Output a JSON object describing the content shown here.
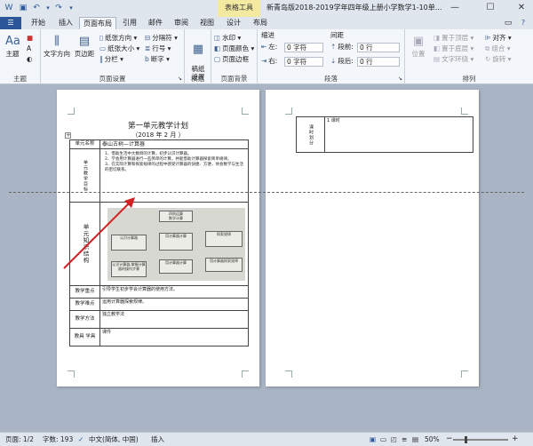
{
  "title_bar": {
    "context_tool": "表格工具",
    "doc_title": "新青岛版2018-2019学年四年级上册小学数学1-10单...",
    "help": "?",
    "restore_ribbon": "▭",
    "minimize": "—",
    "maximize": "☐",
    "close": "✕"
  },
  "tabs": [
    {
      "label": "开始"
    },
    {
      "label": "插入"
    },
    {
      "label": "页面布局"
    },
    {
      "label": "引用"
    },
    {
      "label": "邮件"
    },
    {
      "label": "审阅"
    },
    {
      "label": "视图"
    },
    {
      "label": "设计"
    },
    {
      "label": "布局"
    }
  ],
  "ribbon": {
    "theme": {
      "big_label": "主题",
      "colors": "■",
      "fonts": "A",
      "effects": "◐",
      "group_label": "主题"
    },
    "page_setup": {
      "text_direction": "文字方向",
      "margins": "页边距",
      "orientation": "纸张方向",
      "size": "纸张大小",
      "columns": "分栏",
      "breaks": "分隔符",
      "line_numbers": "行号",
      "hyphenation": "断字",
      "group_label": "页面设置"
    },
    "manuscript": {
      "label": "稿纸\n设置",
      "group_label": "稿纸"
    },
    "page_background": {
      "watermark": "水印",
      "page_color": "页面颜色",
      "page_borders": "页面边框",
      "group_label": "页面背景"
    },
    "paragraph": {
      "indent_title": "缩进",
      "indent_left_label": "左:",
      "indent_left_value": "0 字符",
      "indent_right_label": "右:",
      "indent_right_value": "0 字符",
      "spacing_title": "间距",
      "spacing_before_label": "段前:",
      "spacing_before_value": "0 行",
      "spacing_after_label": "段后:",
      "spacing_after_value": "0 行",
      "group_label": "段落"
    },
    "arrange": {
      "position": "位置",
      "bring_forward": "置于顶层",
      "send_backward": "置于底层",
      "text_wrapping": "文字环绕",
      "align": "对齐",
      "group": "组合",
      "rotate": "旋转",
      "group_label": "排列"
    }
  },
  "document": {
    "page1": {
      "heading": "第一单元教学计划",
      "date": "（2018 年 2 月 ）",
      "rows": {
        "unit_name_label": "单元名称",
        "unit_name_value": "泰山古树—计算器",
        "analysis_label": "单元教学目标",
        "analysis_lines": [
          "1、借助生活中大数目的计算，初步认识计算器。",
          "2、学会用计算器进行一些简单的计算，并能借助计算器探索简单规律。",
          "3、在实际计算和探索规律的过程中感受计算器的快捷、方便，体会数学与生活的密切联系。"
        ],
        "structure_label": "单元知识结构",
        "diagram_title": "四则运算",
        "diagram_sub": "数学计算",
        "diagram_boxes": [
          "认识计算器",
          "用计算器计算",
          "探索规律",
          "认识计算器,掌握计算器的操作步骤",
          "用计算器计算",
          "用计算器探索规律"
        ],
        "key_label": "教学重点",
        "key_value": "引导学生初步学会计算器的使用方法。",
        "difficulty_label": "教学难点",
        "difficulty_value": "运用计算器探索规律。",
        "method_label": "教学方法",
        "method_value": "独立教学法",
        "tools_label": "教具 学具",
        "tools_value": "课件"
      }
    },
    "page2": {
      "label": "课时划分",
      "value": "1 课时"
    }
  },
  "status_bar": {
    "page": "页面: 1/2",
    "words": "字数: 193",
    "language": "中文(简体, 中国)",
    "mode": "插入",
    "zoom": "50%",
    "zoom_out": "−",
    "zoom_in": "+"
  },
  "zoom_level": 0.5,
  "colors": {
    "file_tab": "#2b579a",
    "context_tab": "#f3e9a0",
    "arrow": "#d42020"
  }
}
